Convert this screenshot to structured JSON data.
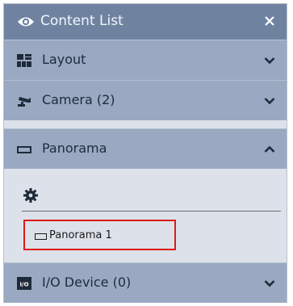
{
  "window": {
    "title": "Content List",
    "icon": "eye-icon",
    "close_icon": "close-icon"
  },
  "sections": [
    {
      "label": "Layout",
      "icon": "layout-grid-icon",
      "expanded": false
    },
    {
      "label": "Camera (2)",
      "icon": "camera-icon",
      "expanded": false
    },
    {
      "label": "Panorama",
      "icon": "panorama-icon",
      "expanded": true
    },
    {
      "label": "I/O Device (0)",
      "icon": "io-device-icon",
      "expanded": false
    }
  ],
  "panorama_content": {
    "settings_icon": "gear-icon",
    "items": [
      {
        "label": "Panorama 1",
        "icon": "panorama-icon",
        "highlighted": true
      }
    ]
  },
  "colors": {
    "title_bar": "#6f83a1",
    "section_header": "#9aa9c1",
    "panel_background": "#dde2ea",
    "highlight_border": "#dd1a1a"
  }
}
